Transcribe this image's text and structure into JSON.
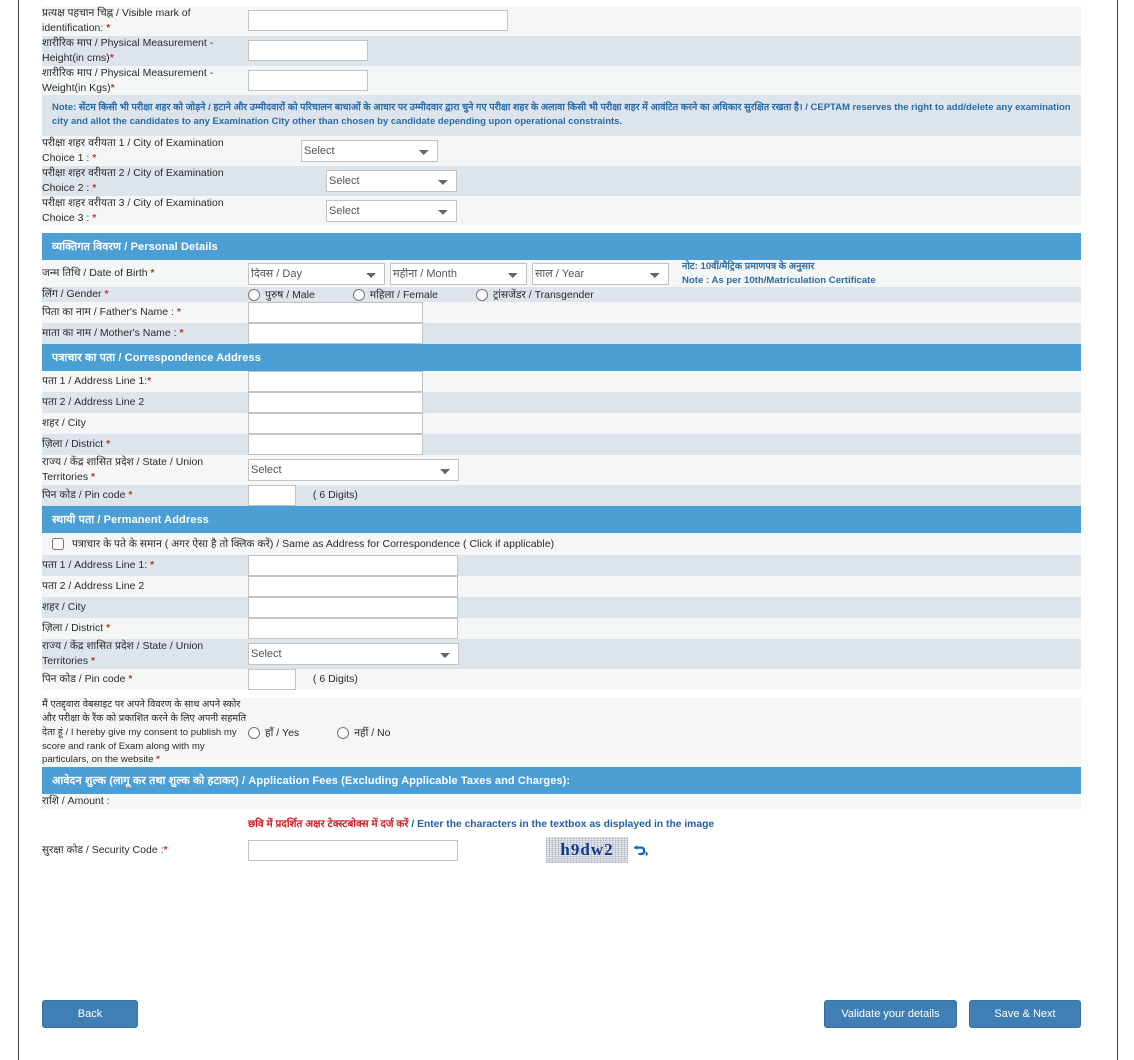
{
  "colors": {
    "section_header_bg": "#4b9fd5",
    "row_alt_bg": "#dee4ec",
    "row_bg": "#f5f6f6",
    "note_text": "#2a6ba8",
    "required_star": "#c0392b",
    "button_bg": "#3f7fb5",
    "captcha_text": "#10388f",
    "instruction_hindi": "#cf2027",
    "instruction_english": "#1f5fa8"
  },
  "top_fields": [
    {
      "label": "प्रत्यक्ष पहचान चिह्न / Visible mark of identification:",
      "required": true,
      "control": "text",
      "width": "w260"
    },
    {
      "label": "शारीरिक माप / Physical Measurement - Height(in cms)",
      "required": true,
      "control": "text",
      "width": "w120"
    },
    {
      "label": "शारीरिक माप / Physical Measurement - Weight(in Kgs)",
      "required": true,
      "control": "text",
      "width": "w120"
    }
  ],
  "note": {
    "hindi": "Note: सेंटम किसी भी परीक्षा शहर को जोड़ने / हटाने और उम्मीदवारों को परिचालन बाधाओं के आधार पर उम्मीदवार द्वारा चुने गए परीक्षा शहर के अलावा किसी भी परीक्षा शहर में आवंटित करने का अधिकार सुरक्षित रखता है। /",
    "english": "CEPTAM reserves the right to add/delete any examination city and allot the candidates to any Examination City other than chosen by candidate depending upon operational constraints."
  },
  "exam_city": {
    "rows": [
      {
        "label": "परीक्षा शहर वरीयता 1 / City of Examination Choice 1 :",
        "required": true,
        "value": "Select"
      },
      {
        "label": "परीक्षा शहर वरीयता 2 / City of Examination Choice 2 :",
        "required": true,
        "value": "Select"
      },
      {
        "label": "परीक्षा शहर वरीयता 3 / City of Examination Choice 3 :",
        "required": true,
        "value": "Select"
      }
    ],
    "placeholder_option": "Select"
  },
  "personal_details": {
    "section_title": "व्यक्तिगत विवरण / Personal Details",
    "dob": {
      "label": "जन्म तिथि / Date of Birth",
      "required": true,
      "day": "दिवस / Day",
      "month": "महीना / Month",
      "year": "साल / Year",
      "note_hindi": "नोट: 10वीं/मैट्रिक प्रमाणपत्र के अनुसार",
      "note_english": "Note : As per 10th/Matriculation Certificate"
    },
    "gender": {
      "label": "लिंग / Gender",
      "required": true,
      "options": [
        "पुरुष / Male",
        "महिला / Female",
        "ट्रांसजेंडर / Transgender"
      ]
    },
    "father_name": {
      "label": "पिता का नाम / Father's Name :",
      "required": true
    },
    "mother_name": {
      "label": "माता का नाम / Mother's Name :",
      "required": true
    }
  },
  "correspondence_address": {
    "section_title": "पत्राचार का पता / Correspondence Address",
    "rows": [
      {
        "label": "पता 1 / Address Line 1:",
        "required": true,
        "control": "text",
        "width": "w175"
      },
      {
        "label": "पता 2 / Address Line 2",
        "required": false,
        "control": "text",
        "width": "w175"
      },
      {
        "label": "शहर / City",
        "required": false,
        "control": "text",
        "width": "w175"
      },
      {
        "label": "ज़िला / District",
        "required": true,
        "control": "text",
        "width": "w175"
      },
      {
        "label": "राज्य / केंद्र शासित प्रदेश / State / Union Territories",
        "required": true,
        "control": "select",
        "value": "Select"
      },
      {
        "label": "पिन कोड / Pin code",
        "required": true,
        "control": "pin",
        "hint": "( 6 Digits)"
      }
    ]
  },
  "permanent_address": {
    "section_title": "स्थायी पता / Permanent Address",
    "same_as_checkbox": "पत्राचार के पते के समान ( अगर ऐसा है तो क्लिक करें) / Same as Address for Correspondence ( Click if applicable)",
    "rows": [
      {
        "label": "पता 1 / Address Line 1:",
        "required": true,
        "control": "text",
        "width": "w175"
      },
      {
        "label": "पता 2 / Address Line 2",
        "required": false,
        "control": "text",
        "width": "w175"
      },
      {
        "label": "शहर / City",
        "required": false,
        "control": "text",
        "width": "w175"
      },
      {
        "label": "ज़िला / District",
        "required": true,
        "control": "text",
        "width": "w175"
      },
      {
        "label": "राज्य / केंद्र शासित प्रदेश / State / Union Territories",
        "required": true,
        "control": "select",
        "value": "Select"
      },
      {
        "label": "पिन कोड / Pin code",
        "required": true,
        "control": "pin",
        "hint": "( 6 Digits)"
      }
    ]
  },
  "consent": {
    "label_hindi": "मैं एतद्द्वारा वेबसाइट पर अपने विवरण के साथ अपने स्कोर और परीक्षा के रैंक को प्रकाशित करने के लिए अपनी सहमति देता हूं /",
    "label_english": "I hereby give my consent to publish my score and rank of Exam along with my particulars, on the website",
    "required": true,
    "options": [
      "हाँ / Yes",
      "नहीं / No"
    ]
  },
  "fees": {
    "section_title": "आवेदन शुल्क (लागू कर तथा शुल्क को हटाकर) / Application Fees (Excluding Applicable Taxes and Charges):",
    "amount_label": "राशि / Amount :",
    "amount_value": ""
  },
  "captcha": {
    "instruction_hindi": "छवि में प्रदर्शित अक्षर टेक्स्टबोक्स में दर्ज करें",
    "instruction_separator": " / ",
    "instruction_english": "Enter the characters in the textbox as displayed in the image",
    "label": "सुरक्षा कोड / Security Code :",
    "required": true,
    "image_text": "h9dw2",
    "refresh_icon_name": "refresh-icon"
  },
  "buttons": {
    "back": "Back",
    "validate": "Validate your details",
    "save_next": "Save & Next"
  }
}
